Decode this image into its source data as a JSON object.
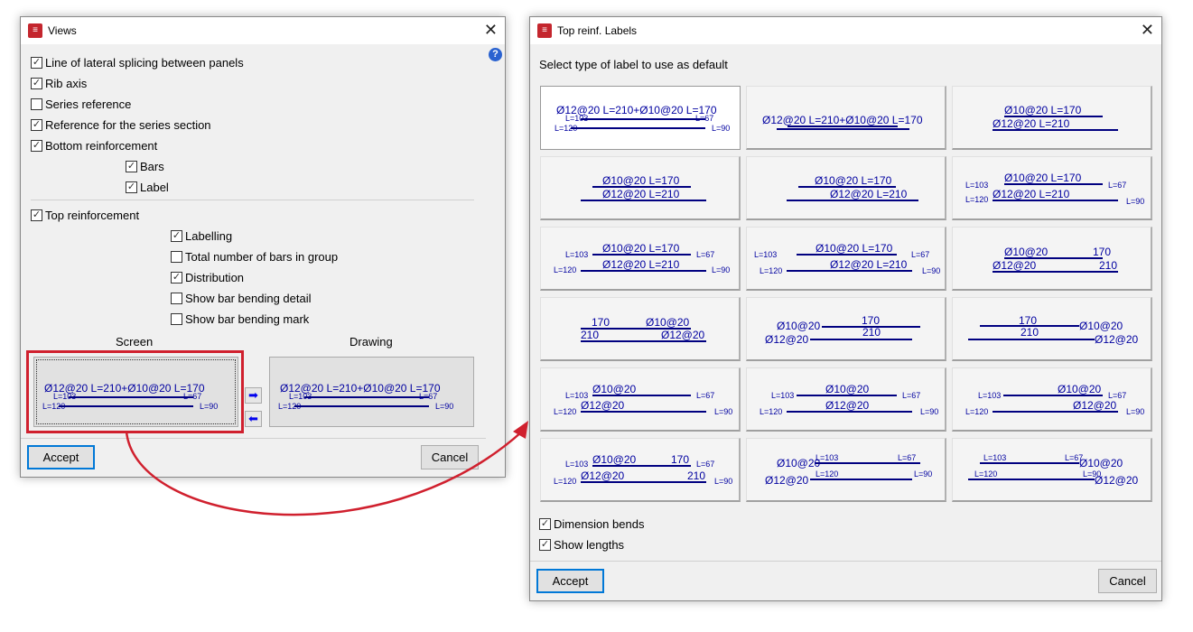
{
  "views": {
    "title": "Views",
    "options": [
      {
        "label": "Line of lateral splicing between panels",
        "checked": true
      },
      {
        "label": "Rib axis",
        "checked": true
      },
      {
        "label": "Series reference",
        "checked": false
      },
      {
        "label": "Reference for the series section",
        "checked": true
      },
      {
        "label": "Bottom reinforcement",
        "checked": true
      },
      {
        "label": "Bars",
        "checked": true
      },
      {
        "label": "Label",
        "checked": true
      },
      {
        "label": "Top reinforcement",
        "checked": true
      },
      {
        "label": "Labelling",
        "checked": true
      },
      {
        "label": "Total number of bars in group",
        "checked": false
      },
      {
        "label": "Distribution",
        "checked": true
      },
      {
        "label": "Show bar bending detail",
        "checked": false
      },
      {
        "label": "Show bar bending mark",
        "checked": false
      }
    ],
    "screen_label": "Screen",
    "drawing_label": "Drawing",
    "preview_texts": [
      "Ø12@20 L=210+Ø10@20 L=170",
      "L=103",
      "L=67",
      "L=120",
      "L=90"
    ],
    "accept": "Accept",
    "cancel": "Cancel"
  },
  "labels": {
    "title": "Top reinf. Labels",
    "prompt": "Select type of label to use as default",
    "selected_index": 0,
    "tiles": [
      [
        "Ø12@20 L=210+Ø10@20 L=170",
        "L=103",
        "L=67",
        "L=120",
        "L=90"
      ],
      [
        "Ø12@20 L=210+Ø10@20 L=170"
      ],
      [
        "Ø10@20 L=170",
        "Ø12@20 L=210"
      ],
      [
        "Ø10@20 L=170",
        "Ø12@20 L=210"
      ],
      [
        "Ø10@20 L=170",
        "Ø12@20 L=210"
      ],
      [
        "L=103",
        "Ø10@20 L=170",
        "L=67",
        "L=120",
        "Ø12@20 L=210",
        "L=90"
      ],
      [
        "L=103",
        "Ø10@20 L=170",
        "L=67",
        "L=120",
        "Ø12@20 L=210",
        "L=90"
      ],
      [
        "L=103",
        "Ø10@20 L=170",
        "L=67",
        "L=120",
        "Ø12@20 L=210",
        "L=90"
      ],
      [
        "Ø10@20",
        "170",
        "Ø12@20",
        "210"
      ],
      [
        "170",
        "Ø10@20",
        "210",
        "Ø12@20"
      ],
      [
        "Ø10@20",
        "170",
        "Ø12@20",
        "210"
      ],
      [
        "170",
        "Ø10@20",
        "210",
        "Ø12@20"
      ],
      [
        "L=103",
        "Ø10@20",
        "L=67",
        "L=120",
        "Ø12@20",
        "L=90"
      ],
      [
        "L=103",
        "Ø10@20",
        "L=67",
        "L=120",
        "Ø12@20",
        "L=90"
      ],
      [
        "L=103",
        "Ø10@20",
        "L=67",
        "L=120",
        "Ø12@20",
        "L=90"
      ],
      [
        "L=103",
        "Ø10@20",
        "170",
        "L=67",
        "L=120",
        "Ø12@20",
        "210",
        "L=90"
      ],
      [
        "Ø10@20",
        "L=103",
        "L=67",
        "Ø12@20",
        "L=120",
        "L=90"
      ],
      [
        "L=103",
        "L=67",
        "Ø10@20",
        "L=120",
        "L=90",
        "Ø12@20"
      ]
    ],
    "options": [
      {
        "label": "Dimension bends",
        "checked": true
      },
      {
        "label": "Show lengths",
        "checked": true
      }
    ],
    "accept": "Accept",
    "cancel": "Cancel"
  },
  "colors": {
    "label_blue": "#0000a0",
    "line_navy": "#000080",
    "highlight_red": "#d0202e"
  }
}
